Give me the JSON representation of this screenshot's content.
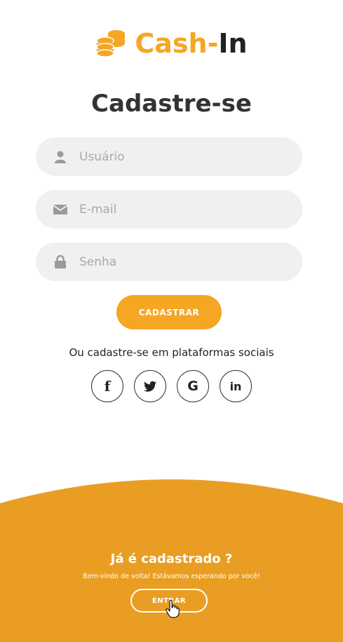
{
  "logo": {
    "part1": "Cash-",
    "part2": "In",
    "icon": "coins-icon"
  },
  "title": "Cadastre-se",
  "form": {
    "username_placeholder": "Usuário",
    "email_placeholder": "E-mail",
    "password_placeholder": "Senha",
    "submit_label": "CADASTRAR"
  },
  "social": {
    "text": "Ou cadastre-se em plataformas sociais",
    "items": [
      {
        "name": "facebook-icon",
        "glyph": "f"
      },
      {
        "name": "twitter-icon",
        "glyph": ""
      },
      {
        "name": "google-icon",
        "glyph": "G"
      },
      {
        "name": "linkedin-icon",
        "glyph": "in"
      }
    ]
  },
  "bottom": {
    "title": "Já é cadastrado ?",
    "subtitle": "Bem-vindo de volta! Estávamos esperando por você!",
    "login_label": "ENTRAR"
  },
  "colors": {
    "accent": "#f5a623",
    "panel": "#e99e23",
    "field_bg": "#f0f0f0",
    "text_dark": "#333333"
  }
}
